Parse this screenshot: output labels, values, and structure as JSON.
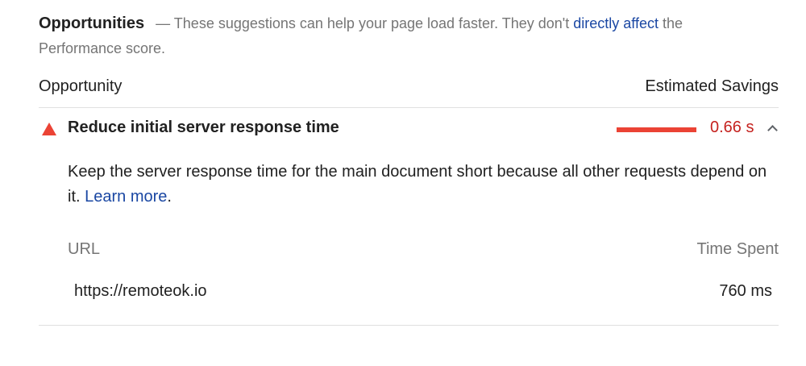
{
  "header": {
    "title": "Opportunities",
    "dash": "—",
    "text_before_link": "These suggestions can help your page load faster. They don't",
    "link_text": "directly affect",
    "text_after_link": "the Performance score."
  },
  "columns": {
    "opportunity": "Opportunity",
    "estimated_savings": "Estimated Savings"
  },
  "audit": {
    "icon": "warning-triangle-icon",
    "title": "Reduce initial server response time",
    "savings_value": "0.66 s",
    "savings_fill_percent": 100,
    "status_color": "#eb4335",
    "expanded": true,
    "description_text": "Keep the server response time for the main document short because all other requests depend on it.",
    "learn_more": "Learn more",
    "description_end": "."
  },
  "details": {
    "headers": {
      "url": "URL",
      "time_spent": "Time Spent"
    },
    "rows": [
      {
        "url": "https://remoteok.io",
        "time_spent": "760 ms"
      }
    ]
  }
}
